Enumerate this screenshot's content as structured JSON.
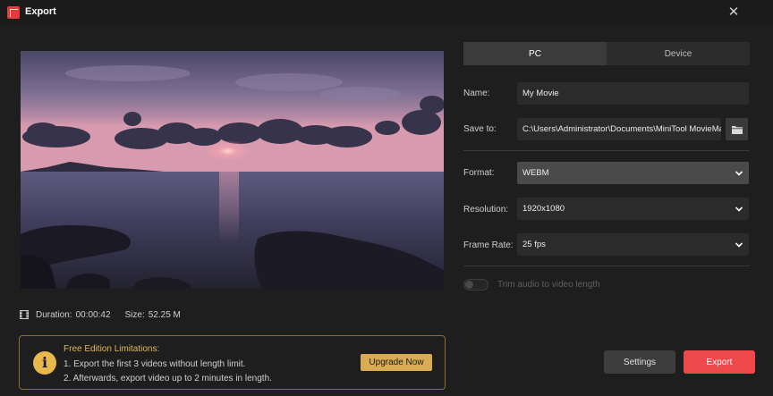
{
  "window": {
    "title": "Export",
    "close_icon": "close-icon"
  },
  "preview": {
    "duration_label": "Duration:",
    "duration": "00:00:42",
    "size_label": "Size:",
    "size": "52.25 M"
  },
  "tabs": [
    {
      "label": "PC",
      "active": true
    },
    {
      "label": "Device",
      "active": false
    }
  ],
  "form": {
    "name_label": "Name:",
    "name_value": "My Movie",
    "save_label": "Save to:",
    "save_value": "C:\\Users\\Administrator\\Documents\\MiniTool MovieMaker",
    "format_label": "Format:",
    "format_value": "WEBM",
    "resolution_label": "Resolution:",
    "resolution_value": "1920x1080",
    "framerate_label": "Frame Rate:",
    "framerate_value": "25 fps",
    "trim_label": "Trim audio to video length",
    "trim_enabled": false
  },
  "limits": {
    "title": "Free Edition Limitations:",
    "line1": "1. Export the first 3 videos without length limit.",
    "line2": "2. Afterwards, export video up to 2 minutes in length.",
    "upgrade_label": "Upgrade Now"
  },
  "buttons": {
    "settings": "Settings",
    "export": "Export"
  },
  "colors": {
    "accent_red": "#f0494c",
    "gold": "#d9ab52",
    "background": "#1e1e1e"
  }
}
